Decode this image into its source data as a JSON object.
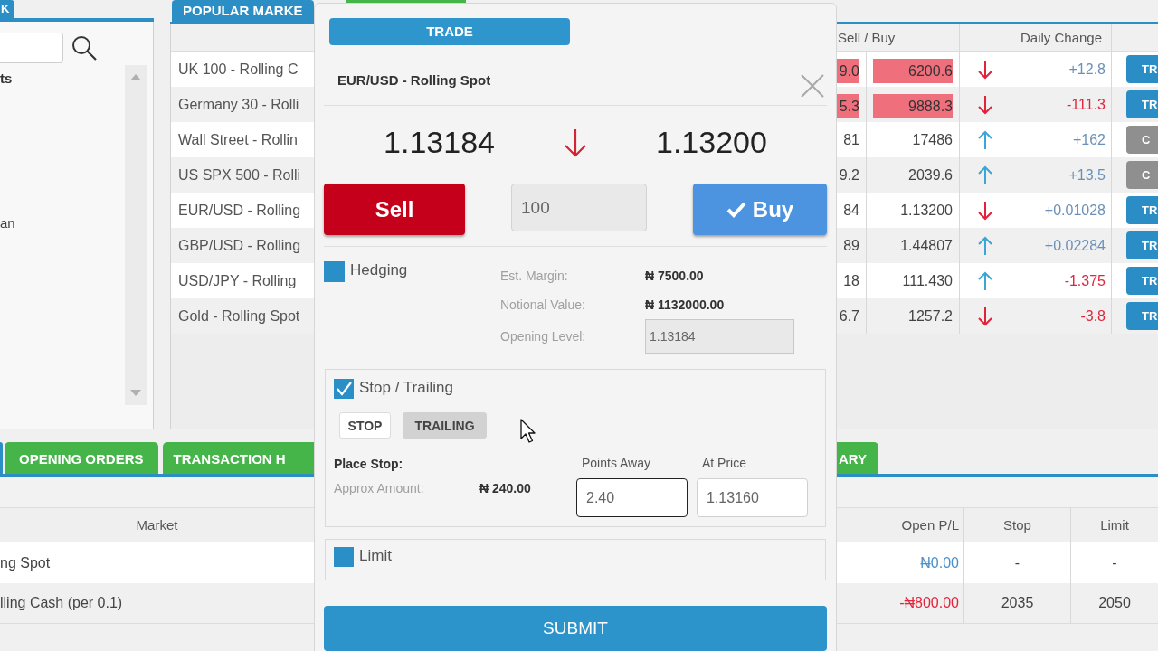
{
  "left_panel": {
    "tab": {
      "label": "K",
      "selected": true
    },
    "list_items": [
      {
        "label": "ts",
        "kind": "heading"
      },
      {
        "label": "an",
        "kind": "item"
      }
    ]
  },
  "popular_markets": {
    "tabs": [
      {
        "label": "POPULAR MARKE",
        "selected": true
      },
      {
        "selected": false
      }
    ],
    "columns": {
      "sell_buy": "Sell / Buy",
      "daily_change": "Daily Change"
    },
    "rows": [
      {
        "market": "UK 100 - Rolling C",
        "sell": "9.0",
        "buy": "6200.6",
        "highlighted": true,
        "rising": false,
        "change": "+12.8",
        "change_negative": false,
        "action": "TR",
        "action_disabled": false
      },
      {
        "market": "Germany 30 - Rolli",
        "sell": "5.3",
        "buy": "9888.3",
        "highlighted": true,
        "rising": false,
        "change": "-111.3",
        "change_negative": true,
        "action": "TR",
        "action_disabled": false
      },
      {
        "market": "Wall Street - Rollin",
        "sell": "81",
        "buy": "17486",
        "highlighted": false,
        "rising": true,
        "change": "+162",
        "change_negative": false,
        "action": "C",
        "action_disabled": true
      },
      {
        "market": "US SPX 500 - Rolli",
        "sell": "9.2",
        "buy": "2039.6",
        "highlighted": false,
        "rising": true,
        "change": "+13.5",
        "change_negative": false,
        "action": "C",
        "action_disabled": true
      },
      {
        "market": "EUR/USD - Rolling",
        "sell": "84",
        "buy": "1.13200",
        "highlighted": false,
        "rising": false,
        "change": "+0.01028",
        "change_negative": false,
        "action": "TR",
        "action_disabled": false
      },
      {
        "market": "GBP/USD - Rolling",
        "sell": "89",
        "buy": "1.44807",
        "highlighted": false,
        "rising": true,
        "change": "+0.02284",
        "change_negative": false,
        "action": "TR",
        "action_disabled": false
      },
      {
        "market": "USD/JPY - Rolling",
        "sell": "18",
        "buy": "111.430",
        "highlighted": false,
        "rising": true,
        "change": "-1.375",
        "change_negative": true,
        "action": "TR",
        "action_disabled": false
      },
      {
        "market": "Gold - Rolling Spot",
        "sell": "6.7",
        "buy": "1257.2",
        "highlighted": false,
        "rising": false,
        "change": "-3.8",
        "change_negative": true,
        "action": "TR",
        "action_disabled": false
      }
    ]
  },
  "positions": {
    "tabs_left": [
      {
        "selected": true
      },
      {
        "label": "OPENING ORDERS",
        "selected": false
      },
      {
        "label": "TRANSACTION H",
        "selected": false
      }
    ],
    "tabs_right": [
      {
        "label": "ARY",
        "selected": false
      }
    ],
    "columns": {
      "market": "Market",
      "open_pl": "Open P/L",
      "stop": "Stop",
      "limit": "Limit"
    },
    "rows": [
      {
        "market": "ng Spot",
        "open_pl": "₦0.00",
        "pl_negative": false,
        "stop": "-",
        "limit": "-"
      },
      {
        "market": "lling Cash (per 0.1)",
        "open_pl": "-₦800.00",
        "pl_negative": true,
        "stop": "2035",
        "limit": "2050"
      }
    ]
  },
  "trade_ticket": {
    "header": "TRADE",
    "market": "EUR/USD - Rolling Spot",
    "sell_price": "1.13184",
    "price_rising": false,
    "buy_price": "1.13200",
    "sell_button": {
      "label": "Sell",
      "selected": false
    },
    "quantity": {
      "value": "100"
    },
    "buy_button": {
      "label": "Buy",
      "selected": true
    },
    "hedging": {
      "label": "Hedging",
      "checked": false
    },
    "details": [
      {
        "label": "Est. Margin:",
        "value": "₦ 7500.00",
        "kind": "text"
      },
      {
        "label": "Notional Value:",
        "value": "₦ 1132000.00",
        "kind": "text"
      },
      {
        "label": "Opening Level:",
        "value": "1.13184",
        "kind": "field"
      }
    ],
    "stop": {
      "label": "Stop / Trailing",
      "checked": true,
      "modes": [
        {
          "label": "STOP",
          "selected": false
        },
        {
          "label": "TRAILING",
          "selected": true
        }
      ],
      "place_label": "Place Stop:",
      "approx_label": "Approx Amount:",
      "approx_value": "₦ 240.00",
      "points_away": {
        "label": "Points Away",
        "value": "2.40",
        "focused": true
      },
      "at_price": {
        "label": "At Price",
        "value": "1.13160",
        "focused": false
      }
    },
    "limit": {
      "label": "Limit",
      "checked": false
    },
    "submit": "SUBMIT"
  }
}
